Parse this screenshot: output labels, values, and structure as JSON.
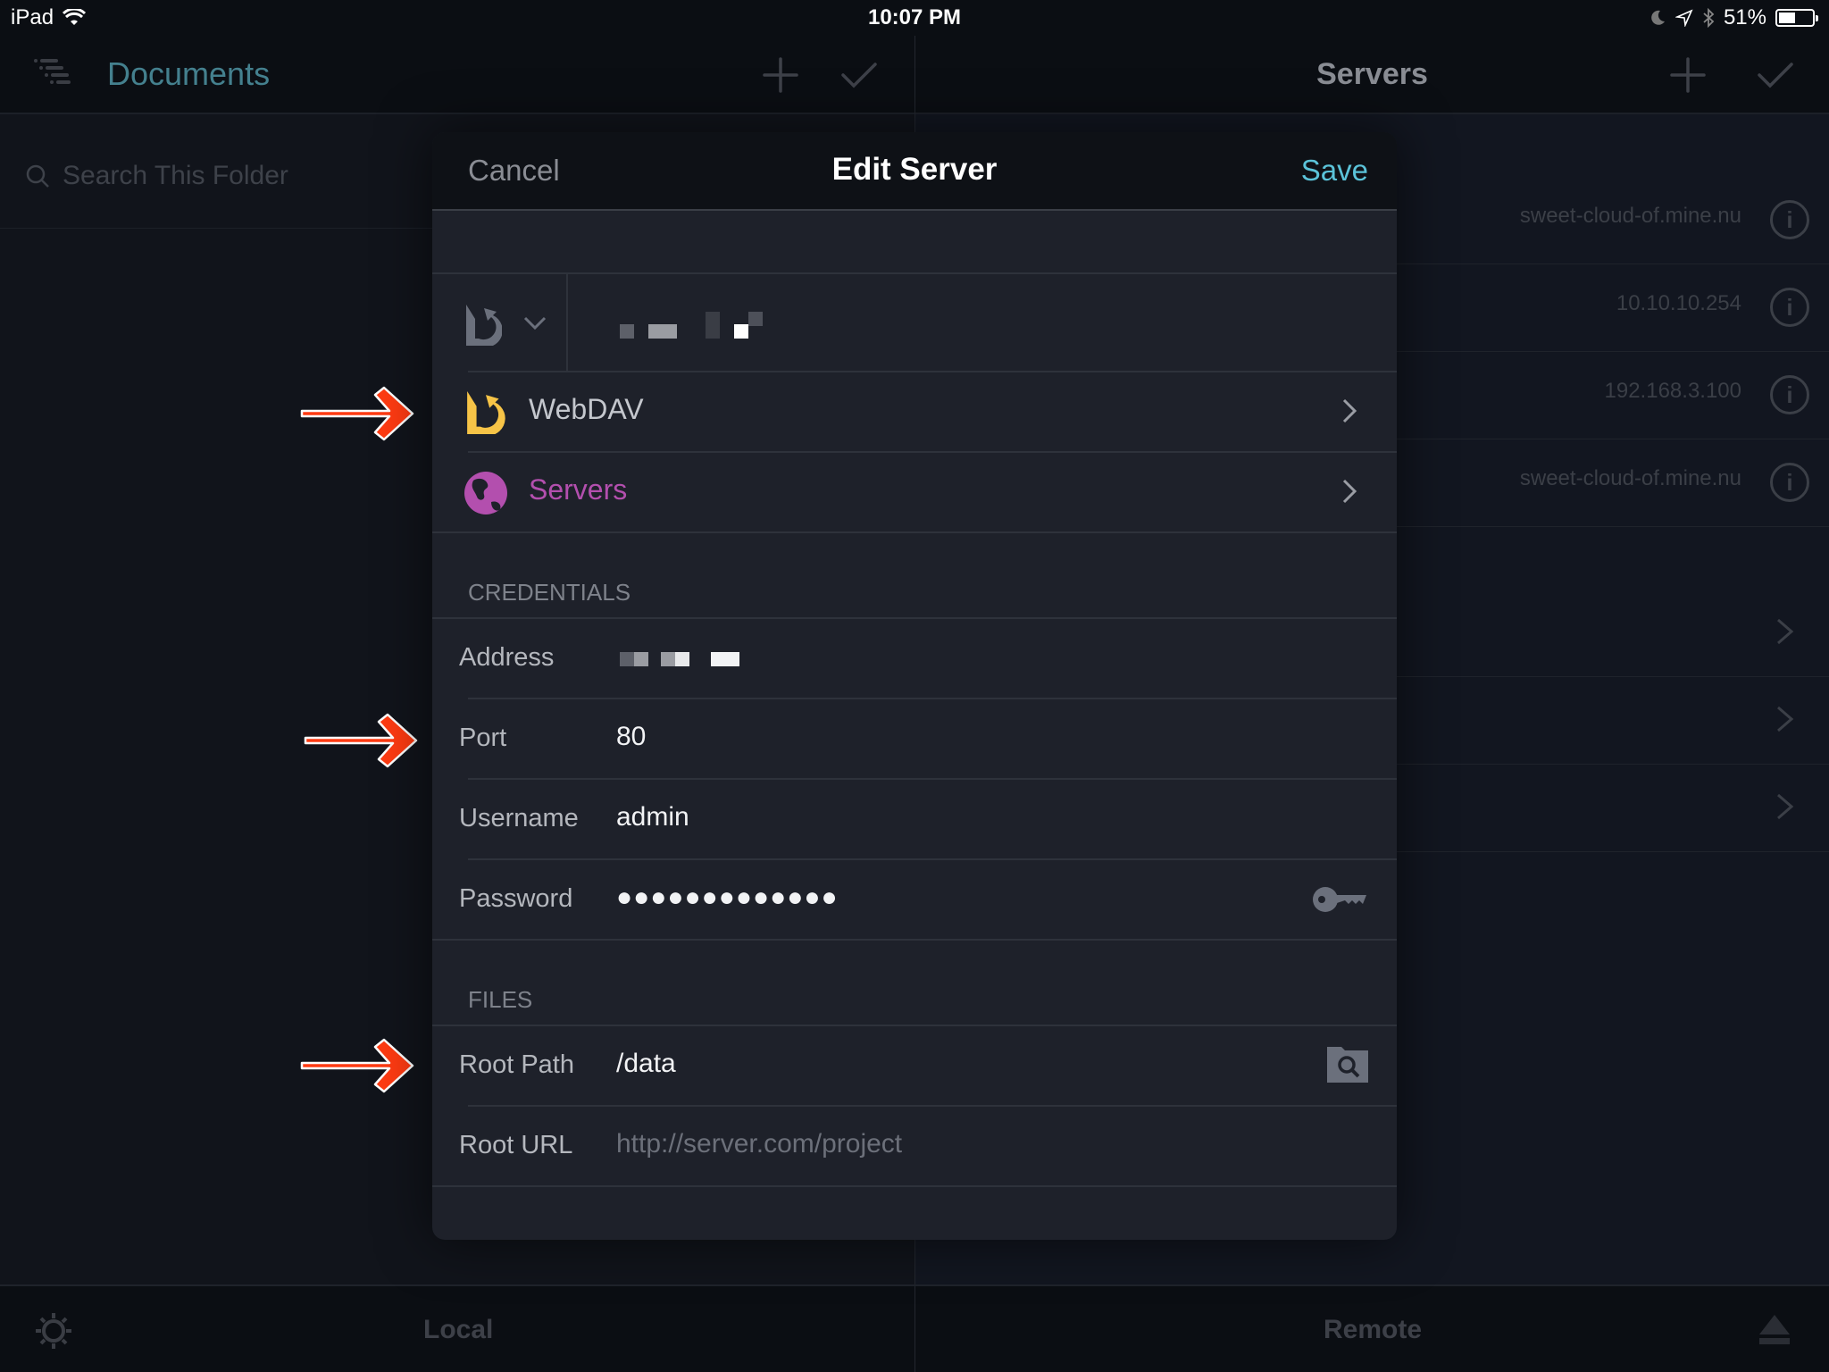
{
  "status_bar": {
    "device": "iPad",
    "time": "10:07 PM",
    "battery_percent_label": "51%",
    "battery_level": 0.51
  },
  "left_panel": {
    "title": "Documents",
    "search_placeholder": "Search This Folder"
  },
  "right_panel": {
    "title": "Servers",
    "servers": [
      {
        "host": "sweet-cloud-of.mine.nu"
      },
      {
        "host": "10.10.10.254"
      },
      {
        "host": "192.168.3.100"
      },
      {
        "host": "sweet-cloud-of.mine.nu"
      }
    ]
  },
  "toolbar": {
    "local_label": "Local",
    "remote_label": "Remote"
  },
  "modal": {
    "cancel_label": "Cancel",
    "title": "Edit Server",
    "save_label": "Save",
    "server_type": "WebDAV",
    "group": "Servers",
    "credentials_header": "CREDENTIALS",
    "files_header": "FILES",
    "fields": {
      "address_label": "Address",
      "port_label": "Port",
      "port_value": "80",
      "username_label": "Username",
      "username_value": "admin",
      "password_label": "Password",
      "password_value": "●●●●●●●●●●●●●",
      "root_path_label": "Root Path",
      "root_path_value": "/data",
      "root_url_label": "Root URL",
      "root_url_placeholder": "http://server.com/project"
    }
  },
  "colors": {
    "accent_teal": "#5bc3d9",
    "documents_title": "#44808e",
    "webdav_yellow": "#f7c447",
    "servers_purple": "#b34fae",
    "annotation_arrow": "#ff3b12"
  }
}
